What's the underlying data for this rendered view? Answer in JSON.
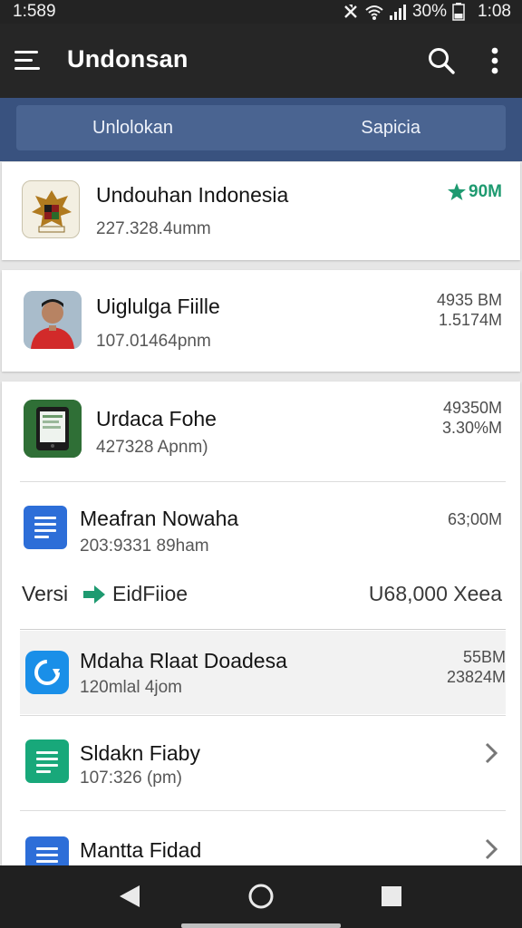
{
  "status_bar": {
    "time_left": "1:589",
    "battery": "30%",
    "time_right": "1:08"
  },
  "app_bar": {
    "title": "Undonsan",
    "icons": [
      "menu-icon",
      "search-icon",
      "more-vert-icon"
    ]
  },
  "tabs": [
    {
      "label": "Unlolokan"
    },
    {
      "label": "Sapicia"
    }
  ],
  "items": [
    {
      "title": "Undouhan Indonesia",
      "subtitle": "227.328.4umm",
      "meta": "90M",
      "meta_color": "#1e9a70",
      "icon": "indonesia-emblem-icon"
    },
    {
      "title": "Uiglulga Fiille",
      "subtitle": "107.01464pnm",
      "meta_line1": "4935 BM",
      "meta_line2": "1.5174M",
      "icon": "profile-photo"
    },
    {
      "title": "Urdaca Fohe",
      "subtitle": "427328 Apnm)",
      "meta_line1": "49350M",
      "meta_line2": "3.30%M",
      "icon": "tablet-app-icon"
    },
    {
      "title": "Meafran Nowaha",
      "subtitle": "203:9331 89ham",
      "meta": "63;00M",
      "icon": "blue-document-icon"
    },
    {
      "title": "Mdaha Rlaat Doadesa",
      "subtitle": "120mlal 4jom",
      "meta_line1": "55BM",
      "meta_line2": "23824M",
      "icon": "refresh-icon"
    },
    {
      "title": "Sldakn Fiaby",
      "subtitle": "107:326 (pm)",
      "icon": "green-document-icon"
    },
    {
      "title": "Mantta Fidad",
      "icon": "blue-document-icon"
    }
  ],
  "version_row": {
    "label": "Versi",
    "file": "EidFiioe",
    "value": "U68,000 Xeea",
    "icon": "green-arrow-icon"
  },
  "nav": [
    "back-icon",
    "home-icon",
    "recents-icon"
  ],
  "colors": {
    "app_bar": "#262626",
    "tab_strip": "#39527f",
    "accent_green": "#1e9a70",
    "blue_icon": "#2d6ed8"
  }
}
